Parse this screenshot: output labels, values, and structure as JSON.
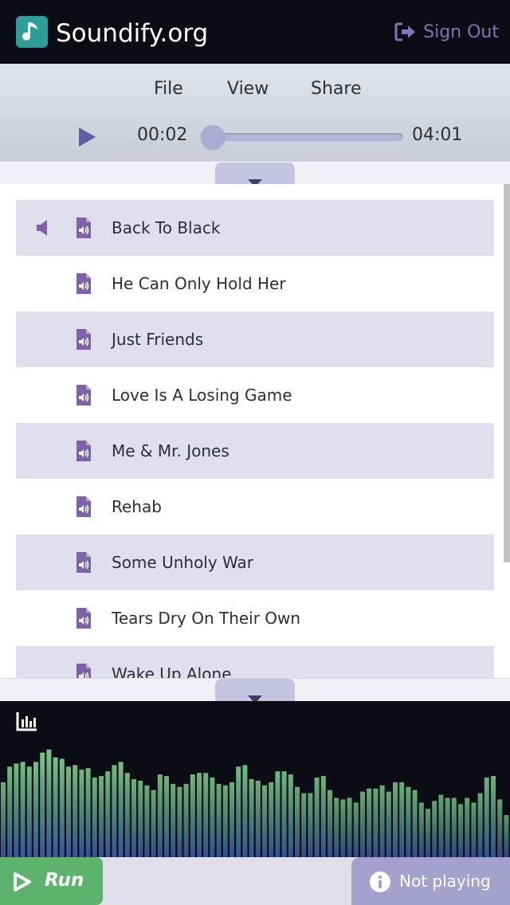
{
  "header": {
    "app_title": "Soundify.org",
    "signout_label": "Sign Out"
  },
  "toolbar": {
    "menu": [
      "File",
      "View",
      "Share"
    ],
    "current_time": "00:02",
    "duration": "04:01",
    "progress_fraction": 0.008
  },
  "playlist": {
    "now_playing_index": 0,
    "tracks": [
      "Back To Black",
      "He Can Only Hold Her",
      "Just Friends",
      "Love Is A Losing Game",
      "Me & Mr. Jones",
      "Rehab",
      "Some Unholy War",
      "Tears Dry On Their Own",
      "Wake Up Alone"
    ]
  },
  "footer": {
    "run_label": "Run",
    "status_label": "Not playing"
  },
  "colors": {
    "accent": "#7e74b8",
    "brand": "#2f9e99",
    "run_green": "#5db36d",
    "row_alt": "#dfdfee"
  },
  "icons": {
    "logo": "music-note-icon",
    "signout": "sign-out-icon",
    "play": "play-icon",
    "collapse": "chevron-down-icon",
    "speaker": "speaker-icon",
    "file": "audio-file-icon",
    "visualizer": "bar-chart-icon",
    "info": "info-icon"
  },
  "visualizer": {
    "levels": [
      0.48,
      0.58,
      0.6,
      0.61,
      0.58,
      0.61,
      0.67,
      0.69,
      0.64,
      0.63,
      0.58,
      0.59,
      0.56,
      0.57,
      0.51,
      0.52,
      0.55,
      0.59,
      0.61,
      0.54,
      0.5,
      0.49,
      0.46,
      0.43,
      0.53,
      0.52,
      0.47,
      0.45,
      0.47,
      0.53,
      0.54,
      0.54,
      0.51,
      0.47,
      0.46,
      0.48,
      0.58,
      0.59,
      0.5,
      0.49,
      0.46,
      0.48,
      0.55,
      0.55,
      0.53,
      0.45,
      0.41,
      0.41,
      0.51,
      0.52,
      0.43,
      0.38,
      0.37,
      0.38,
      0.35,
      0.42,
      0.44,
      0.44,
      0.46,
      0.42,
      0.48,
      0.48,
      0.45,
      0.43,
      0.35,
      0.31,
      0.36,
      0.4,
      0.38,
      0.38,
      0.34,
      0.38,
      0.35,
      0.41,
      0.51,
      0.52,
      0.37,
      0.27
    ]
  }
}
